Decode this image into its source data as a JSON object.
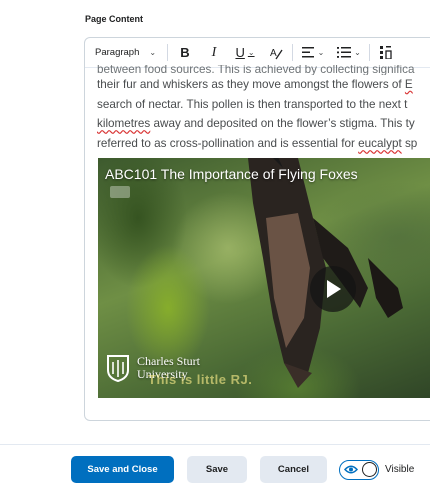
{
  "section": {
    "label": "Page Content"
  },
  "toolbar": {
    "paragraph_label": "Paragraph",
    "bold_label": "B",
    "italic_label": "I",
    "underline_label": "U",
    "format_label": "A",
    "chevron": "⌄"
  },
  "content": {
    "partial_line": "between food sources. This is achieved by collecting significa",
    "line1_a": "their fur and whiskers as they move amongst the flowers of ",
    "line1_b": "E",
    "line2": "search of nectar. This pollen is then transported to the next t",
    "line3_a": "kilometres",
    "line3_b": " away and deposited on the flower’s stigma. This ty",
    "line4_a": "referred to as cross-pollination and is essential for ",
    "line4_b": "eucalypt",
    "line4_c": " sp"
  },
  "video": {
    "title": "ABC101 The Importance of Flying Foxes",
    "logo_line1": "Charles Sturt",
    "logo_line2": "University",
    "caption_overlay": "This is little RJ."
  },
  "footer": {
    "save_close_label": "Save and Close",
    "save_label": "Save",
    "cancel_label": "Cancel",
    "visible_label": "Visible",
    "visible_on": true
  },
  "colors": {
    "primary": "#006fbf",
    "secondary_button": "#e3e9f1",
    "text": "#202122",
    "body_text": "#494c4e",
    "spellcheck": "#d93636"
  },
  "icons": [
    "chevron-down-icon",
    "text-format-icon",
    "align-left-icon",
    "list-icon",
    "more-options-icon",
    "play-icon",
    "university-shield-icon",
    "eye-icon"
  ]
}
